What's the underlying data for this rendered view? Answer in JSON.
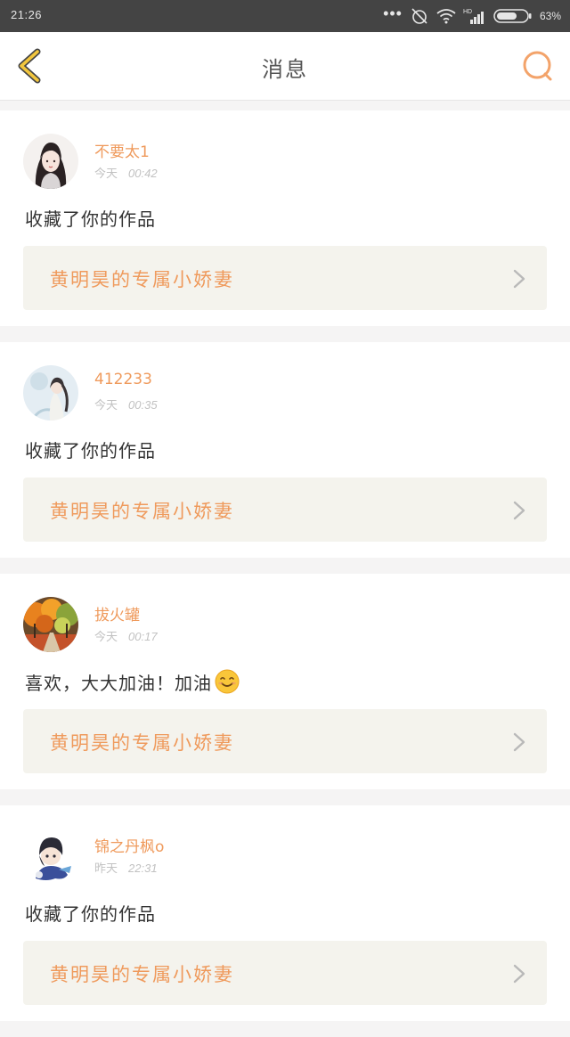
{
  "status_bar": {
    "time": "21:26",
    "battery": "63%",
    "network": "HD"
  },
  "header": {
    "title": "消息"
  },
  "notifications": [
    {
      "user": "不要太1",
      "day": "今天",
      "time": "00:42",
      "message": "收藏了你的作品",
      "work_title": "黄明昊的专属小娇妻",
      "avatar_icon": "girl-portrait-avatar"
    },
    {
      "user": "412233",
      "day": "今天",
      "time": "00:35",
      "message": "收藏了你的作品",
      "work_title": "黄明昊的专属小娇妻",
      "avatar_icon": "girl-illustration-avatar"
    },
    {
      "user": "拔火罐",
      "day": "今天",
      "time": "00:17",
      "message": "喜欢，大大加油！加油",
      "work_title": "黄明昊的专属小娇妻",
      "avatar_icon": "autumn-trees-avatar",
      "emoji": "smile-emoji"
    },
    {
      "user": "锦之丹枫o",
      "day": "昨天",
      "time": "22:31",
      "message": "收藏了你的作品",
      "work_title": "黄明昊的专属小娇妻",
      "avatar_icon": "cartoon-character-avatar"
    }
  ],
  "colors": {
    "accent": "#ef9a5c",
    "back_icon": "#f2c63e",
    "link_bg": "#f4f3ed",
    "page_bg": "#f5f4f4"
  }
}
